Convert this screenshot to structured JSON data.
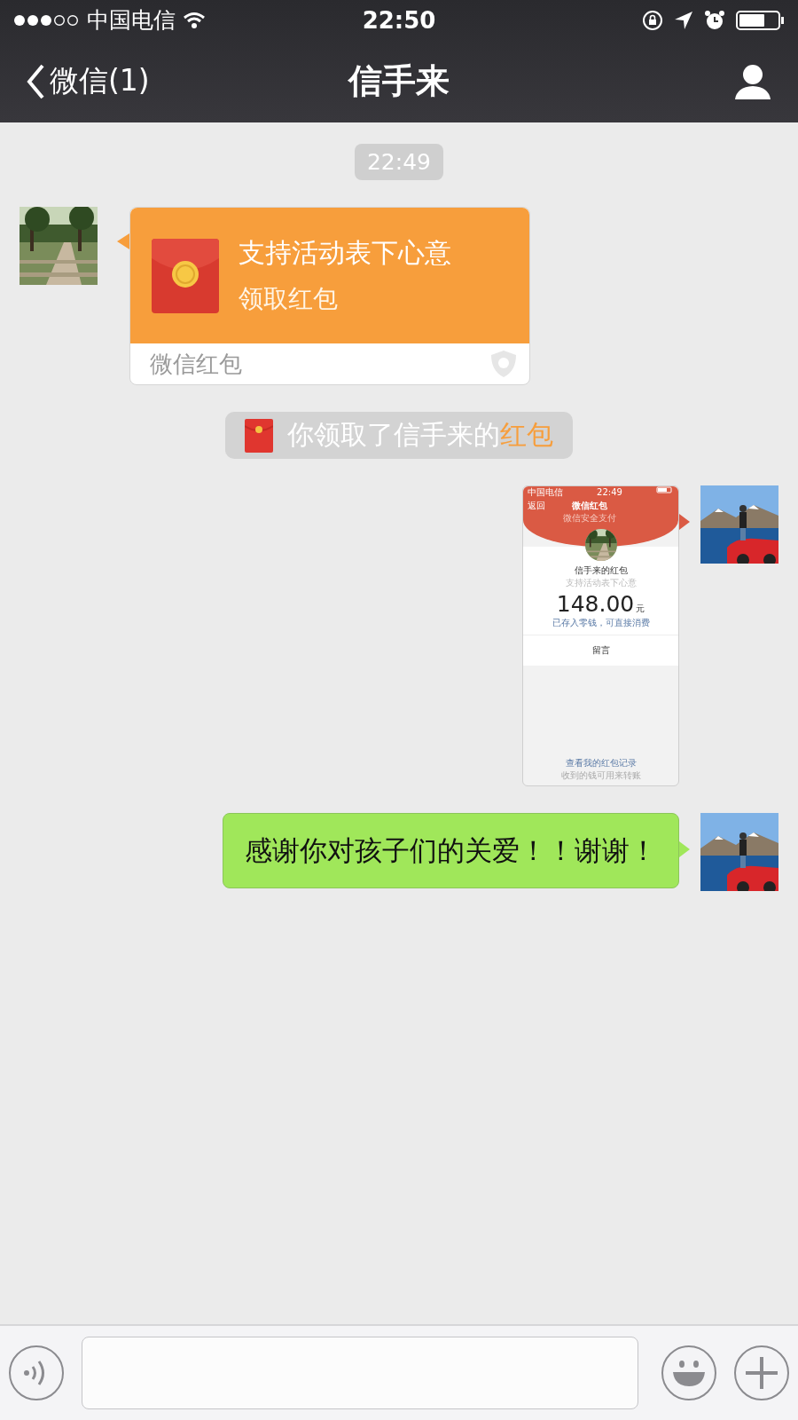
{
  "status_bar": {
    "carrier": "中国电信",
    "time": "22:50"
  },
  "nav_bar": {
    "back_label": "微信(1)",
    "title": "信手来"
  },
  "messages": [
    {
      "kind": "timestamp",
      "text": "22:49"
    },
    {
      "kind": "red_packet",
      "outgoing": false,
      "title": "支持活动表下心意",
      "subtitle": "领取红包",
      "footer": "微信红包"
    },
    {
      "kind": "notice",
      "text": "你领取了信手来的",
      "link": "红包"
    },
    {
      "outgoing": true,
      "screenshot": {
        "carrier": "中国电信",
        "time": "22:49",
        "back": "返回",
        "title": "微信红包",
        "subtitle": "微信安全支付",
        "sender": "信手来的红包",
        "wish": "支持活动表下心意",
        "amount": "148.00",
        "unit": "元",
        "note": "已存入零钱，可直接消费",
        "reply": "留言",
        "records_link": "查看我的红包记录",
        "footer_note": "收到的钱可用来转账"
      }
    },
    {
      "kind": "text",
      "outgoing": true,
      "text": "感谢你对孩子们的关爱！！谢谢！"
    }
  ]
}
